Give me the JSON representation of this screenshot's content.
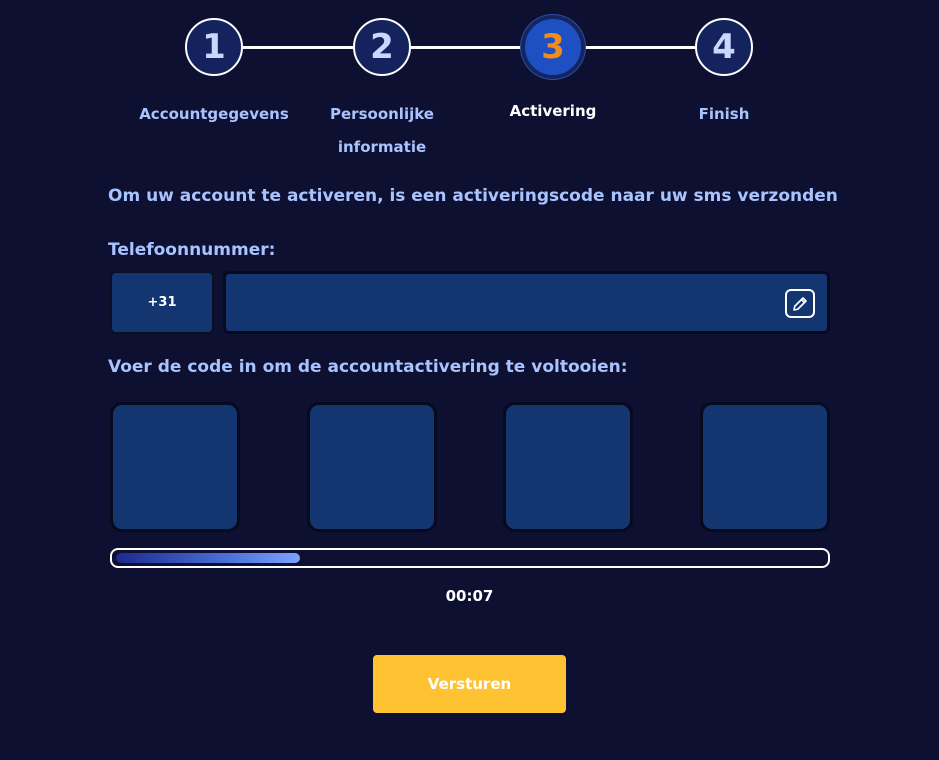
{
  "stepper": {
    "steps": [
      {
        "number": "1",
        "label": "Accountgegevens"
      },
      {
        "number": "2",
        "label_line1": "Persoonlijke",
        "label_line2": "informatie"
      },
      {
        "number": "3",
        "label": "Activering"
      },
      {
        "number": "4",
        "label": "Finish"
      }
    ],
    "active_step": 3
  },
  "info_text": "Om uw account te activeren, is een activeringscode naar uw sms verzonden",
  "phone": {
    "label": "Telefoonnummer:",
    "prefix": "+31",
    "value": "",
    "edit_icon": "pencil-icon"
  },
  "code": {
    "label": "Voer de code in om de accountactivering te voltooien:",
    "digits": [
      "",
      "",
      "",
      ""
    ]
  },
  "progress": {
    "fraction": 0.26
  },
  "timer": "00:07",
  "submit_label": "Versturen",
  "colors": {
    "background": "#0d1030",
    "field": "#133671",
    "label": "#a9c3ff",
    "active_step": "#1e50c4",
    "active_number": "#f08c1e",
    "button": "#ffc233"
  }
}
